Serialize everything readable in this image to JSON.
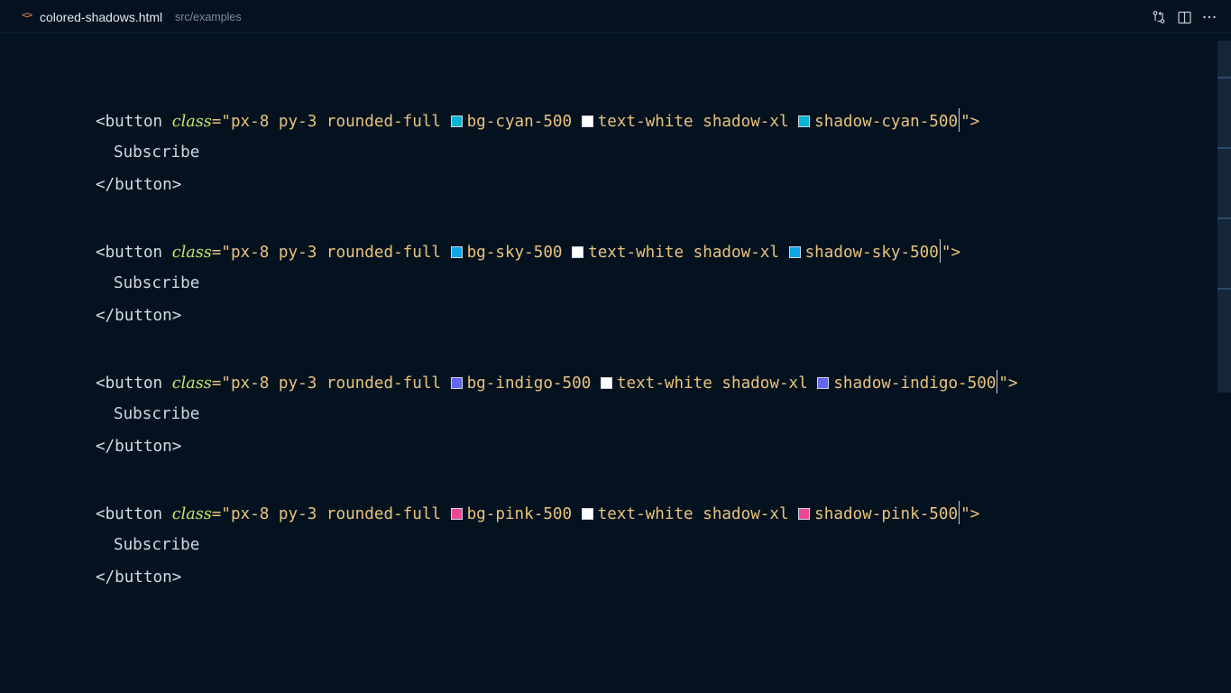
{
  "tab": {
    "icon": "code-brackets-icon",
    "filename": "colored-shadows.html",
    "path": "src/examples"
  },
  "toolbar": {
    "icons": [
      "source-control-compare-icon",
      "split-editor-icon",
      "more-actions-icon"
    ]
  },
  "code": {
    "open_tag": "<button",
    "attr_name": "class",
    "eq_quote": "=\"",
    "static_classes": "px-8 py-3 rounded-full ",
    "mid_classes": "text-white shadow-xl ",
    "close_quote": "\">",
    "body_text": "Subscribe",
    "closing_tag": "</button>",
    "blocks": [
      {
        "bg_class": "bg-cyan-500",
        "bg_color": "#06b6d4",
        "text_color_swatch": "#ffffff",
        "shadow_class": "shadow-cyan-500",
        "shadow_color": "#06b6d4"
      },
      {
        "bg_class": "bg-sky-500",
        "bg_color": "#0ea5e9",
        "text_color_swatch": "#ffffff",
        "shadow_class": "shadow-sky-500",
        "shadow_color": "#0ea5e9"
      },
      {
        "bg_class": "bg-indigo-500",
        "bg_color": "#6366f1",
        "text_color_swatch": "#ffffff",
        "shadow_class": "shadow-indigo-500",
        "shadow_color": "#6366f1"
      },
      {
        "bg_class": "bg-pink-500",
        "bg_color": "#ec4899",
        "text_color_swatch": "#ffffff",
        "shadow_class": "shadow-pink-500",
        "shadow_color": "#ec4899"
      }
    ]
  }
}
